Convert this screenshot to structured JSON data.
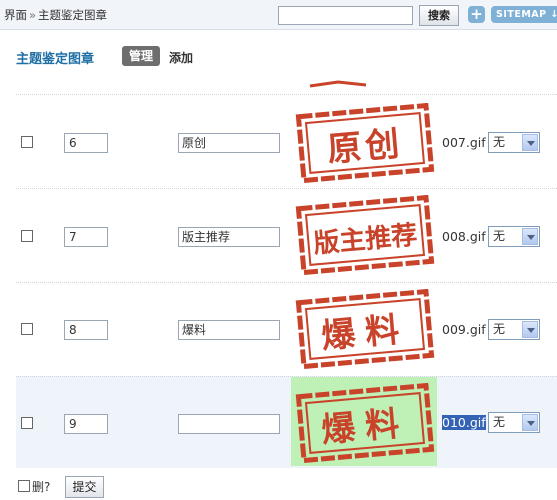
{
  "breadcrumb": {
    "parent": "界面",
    "separator": "»",
    "current": "主题鉴定图章"
  },
  "search": {
    "value": "",
    "button_label": "搜索"
  },
  "toolbar": {
    "plus_label": "+",
    "sitemap_label": "SITEMAP ↓"
  },
  "header": {
    "title": "主题鉴定图章",
    "tab_manage": "管理",
    "tab_add": "添加"
  },
  "rows": [
    {
      "order": "6",
      "name": "原创",
      "stamp_text": "原创",
      "file": "007.gif",
      "select": "无"
    },
    {
      "order": "7",
      "name": "版主推荐",
      "stamp_text": "版主推荐",
      "file": "008.gif",
      "select": "无"
    },
    {
      "order": "8",
      "name": "爆料",
      "stamp_text": "爆料",
      "file": "009.gif",
      "select": "无"
    },
    {
      "order": "9",
      "name": "",
      "stamp_text": "爆料",
      "file": "010.gif",
      "select": "无"
    }
  ],
  "footer": {
    "delete_label": "删?",
    "submit_label": "提交"
  },
  "colors": {
    "stamp_red": "#c8432a",
    "stamp_bg_selected": "#bff0b6",
    "accent_blue": "#1f6fa5"
  }
}
